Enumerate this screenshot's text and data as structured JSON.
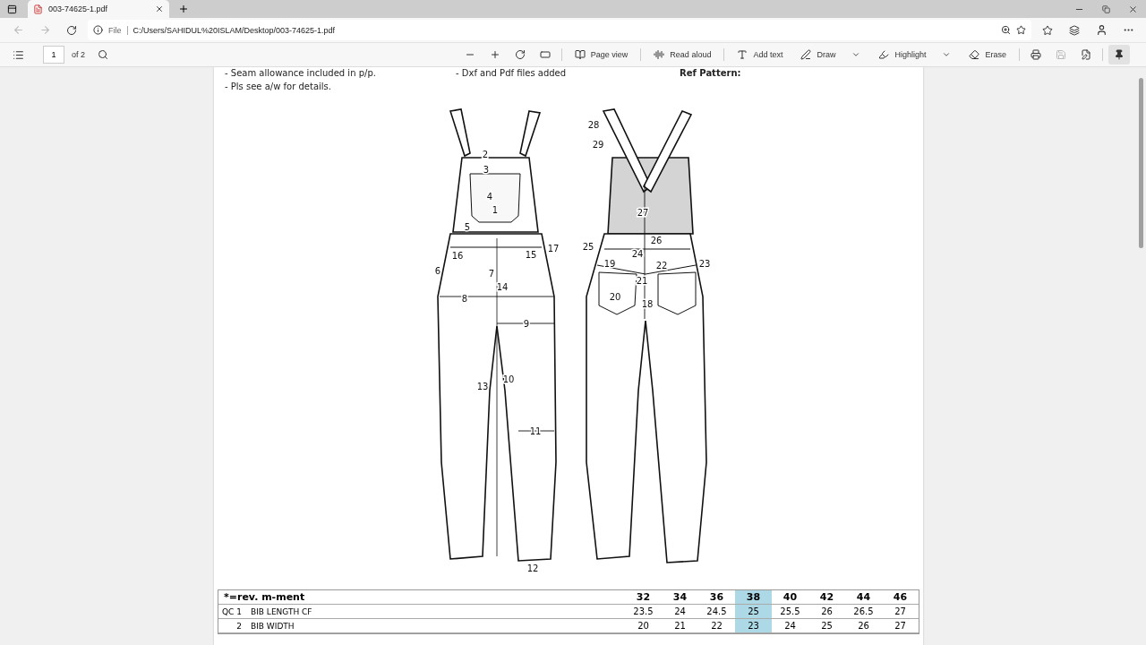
{
  "browser": {
    "tab": {
      "title": "003-74625-1.pdf",
      "selected": true
    },
    "nav": {
      "back_disabled": true,
      "forward_disabled": true
    },
    "address": {
      "scheme": "File",
      "url": "C:/Users/SAHIDUL%20ISLAM/Desktop/003-74625-1.pdf"
    }
  },
  "pdf_toolbar": {
    "page_number": "1",
    "page_count": "of 2",
    "save_disabled": true,
    "pinned": true,
    "tools": [
      {
        "kind": "page-view",
        "label": "Page view",
        "has_menu": false
      },
      {
        "kind": "read-aloud",
        "label": "Read aloud",
        "has_menu": false
      },
      {
        "kind": "text",
        "label": "Add text",
        "has_menu": false
      },
      {
        "kind": "draw",
        "label": "Draw",
        "has_menu": true
      },
      {
        "kind": "highlight",
        "label": "Highlight",
        "has_menu": true
      },
      {
        "kind": "erase",
        "label": "Erase",
        "has_menu": false
      }
    ]
  },
  "document": {
    "notes": [
      [
        "- Seam allowance included in p/p.",
        "- Pls see a/w for details."
      ],
      [
        "- Dxf and Pdf files added"
      ],
      [
        "Ref Pattern:"
      ]
    ],
    "sketch": {
      "front_labels": [
        "2",
        "3",
        "4",
        "1",
        "5",
        "16",
        "15",
        "17",
        "6",
        "7",
        "14",
        "8",
        "9",
        "10",
        "13",
        "11",
        "12"
      ],
      "back_labels": [
        "28",
        "29",
        "27",
        "26",
        "25",
        "24",
        "19",
        "22",
        "23",
        "21",
        "20",
        "18"
      ]
    },
    "table": {
      "title": "*=rev. m-ment",
      "sizes": [
        {
          "label": "32",
          "selected": false
        },
        {
          "label": "34",
          "selected": false
        },
        {
          "label": "36",
          "selected": false
        },
        {
          "label": "38",
          "selected": true
        },
        {
          "label": "40",
          "selected": false
        },
        {
          "label": "42",
          "selected": false
        },
        {
          "label": "44",
          "selected": false
        },
        {
          "label": "46",
          "selected": false
        }
      ],
      "rows": [
        {
          "code": "QC 1",
          "name": "BIB LENGTH CF",
          "values": [
            "23.5",
            "24",
            "24.5",
            "25",
            "25.5",
            "26",
            "26.5",
            "27"
          ]
        },
        {
          "code": "2",
          "name": "BIB WIDTH",
          "values": [
            "20",
            "21",
            "22",
            "23",
            "24",
            "25",
            "26",
            "27"
          ]
        }
      ]
    }
  }
}
